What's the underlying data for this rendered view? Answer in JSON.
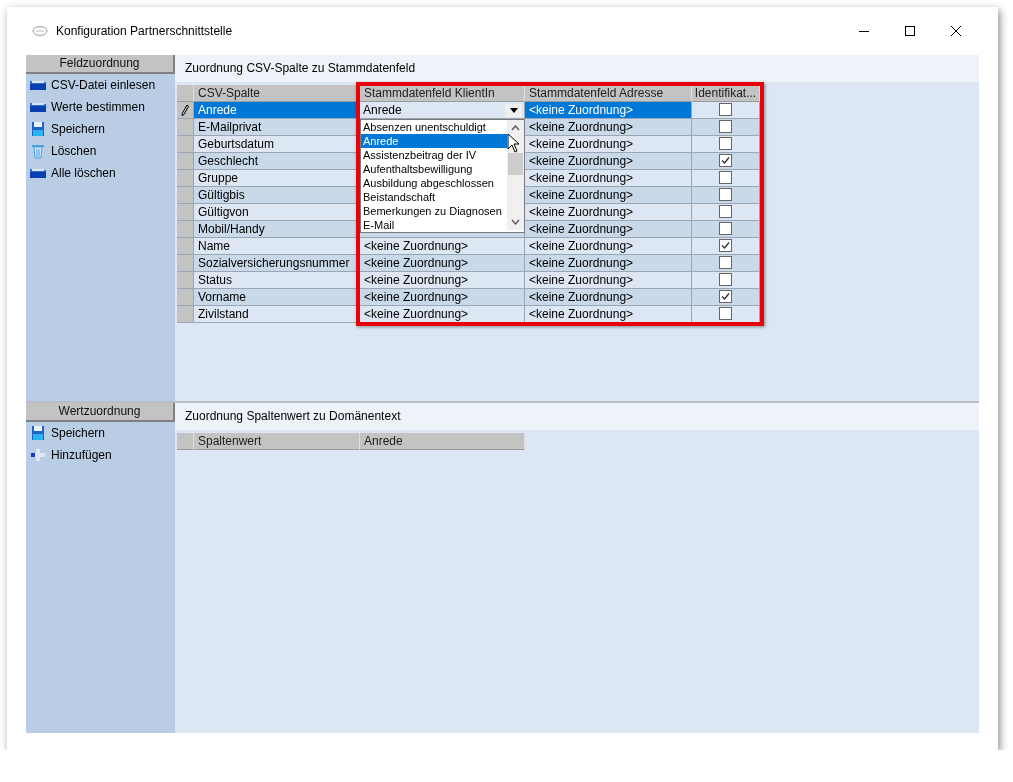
{
  "window": {
    "title": "Konfiguration Partnerschnittstelle"
  },
  "sections": [
    {
      "sidebar": {
        "title": "Feldzuordnung",
        "items": [
          {
            "label": "CSV-Datei einlesen",
            "kind": "folder"
          },
          {
            "label": "Werte bestimmen",
            "kind": "folder"
          },
          {
            "label": "Speichern",
            "kind": "save"
          },
          {
            "label": "Löschen",
            "kind": "trash"
          },
          {
            "label": "Alle löschen",
            "kind": "folder"
          }
        ]
      },
      "panel": {
        "title": "Zuordnung CSV-Spalte zu Stammdatenfeld",
        "columns": [
          "CSV-Spalte",
          "Stammdatenfeld KlientIn",
          "Stammdatenfeld Adresse",
          "Identifikat..."
        ],
        "rows": [
          {
            "csv": "Anrede",
            "klient": "Anrede",
            "adresse": "<keine Zuordnung>",
            "identifikation": false,
            "selected": true,
            "editing": true
          },
          {
            "csv": "E-Mailprivat",
            "adresse": "<keine Zuordnung>",
            "identifikation": false,
            "selected": false,
            "editing": false
          },
          {
            "csv": "Geburtsdatum",
            "adresse": "<keine Zuordnung>",
            "identifikation": false,
            "selected": false,
            "editing": false
          },
          {
            "csv": "Geschlecht",
            "adresse": "<keine Zuordnung>",
            "identifikation": true,
            "selected": false,
            "editing": false
          },
          {
            "csv": "Gruppe",
            "adresse": "<keine Zuordnung>",
            "identifikation": false,
            "selected": false,
            "editing": false
          },
          {
            "csv": "Gültigbis",
            "adresse": "<keine Zuordnung>",
            "identifikation": false,
            "selected": false,
            "editing": false
          },
          {
            "csv": "Gültigvon",
            "adresse": "<keine Zuordnung>",
            "identifikation": false,
            "selected": false,
            "editing": false
          },
          {
            "csv": "Mobil/Handy",
            "adresse": "<keine Zuordnung>",
            "identifikation": false,
            "selected": false,
            "editing": false
          },
          {
            "csv": "Name",
            "klient": "<keine Zuordnung>",
            "adresse": "<keine Zuordnung>",
            "identifikation": true,
            "selected": false,
            "editing": false
          },
          {
            "csv": "Sozialversicherungsnummer",
            "klient": "<keine Zuordnung>",
            "adresse": "<keine Zuordnung>",
            "identifikation": false,
            "selected": false,
            "editing": false
          },
          {
            "csv": "Status",
            "klient": "<keine Zuordnung>",
            "adresse": "<keine Zuordnung>",
            "identifikation": false,
            "selected": false,
            "editing": false
          },
          {
            "csv": "Vorname",
            "klient": "<keine Zuordnung>",
            "adresse": "<keine Zuordnung>",
            "identifikation": true,
            "selected": false,
            "editing": false
          },
          {
            "csv": "Zivilstand",
            "klient": "<keine Zuordnung>",
            "adresse": "<keine Zuordnung>",
            "identifikation": false,
            "selected": false,
            "editing": false
          }
        ],
        "dropdown": {
          "items": [
            {
              "label": "Absenzen unentschuldigt",
              "selected": false
            },
            {
              "label": "Anrede",
              "selected": true
            },
            {
              "label": "Assistenzbeitrag der IV",
              "selected": false
            },
            {
              "label": "Aufenthaltsbewilligung",
              "selected": false
            },
            {
              "label": "Ausbildung abgeschlossen",
              "selected": false
            },
            {
              "label": "Beistandschaft",
              "selected": false
            },
            {
              "label": "Bemerkungen zu Diagnosen",
              "selected": false
            },
            {
              "label": "E-Mail",
              "selected": false
            }
          ]
        },
        "highlight": true
      }
    },
    {
      "sidebar": {
        "title": "Wertzuordnung",
        "items": [
          {
            "label": "Speichern",
            "kind": "save"
          },
          {
            "label": "Hinzufügen",
            "kind": "add"
          }
        ]
      },
      "panel": {
        "title": "Zuordnung Spaltenwert zu Domänentext",
        "columns": [
          "Spaltenwert",
          "Anrede"
        ]
      }
    }
  ]
}
